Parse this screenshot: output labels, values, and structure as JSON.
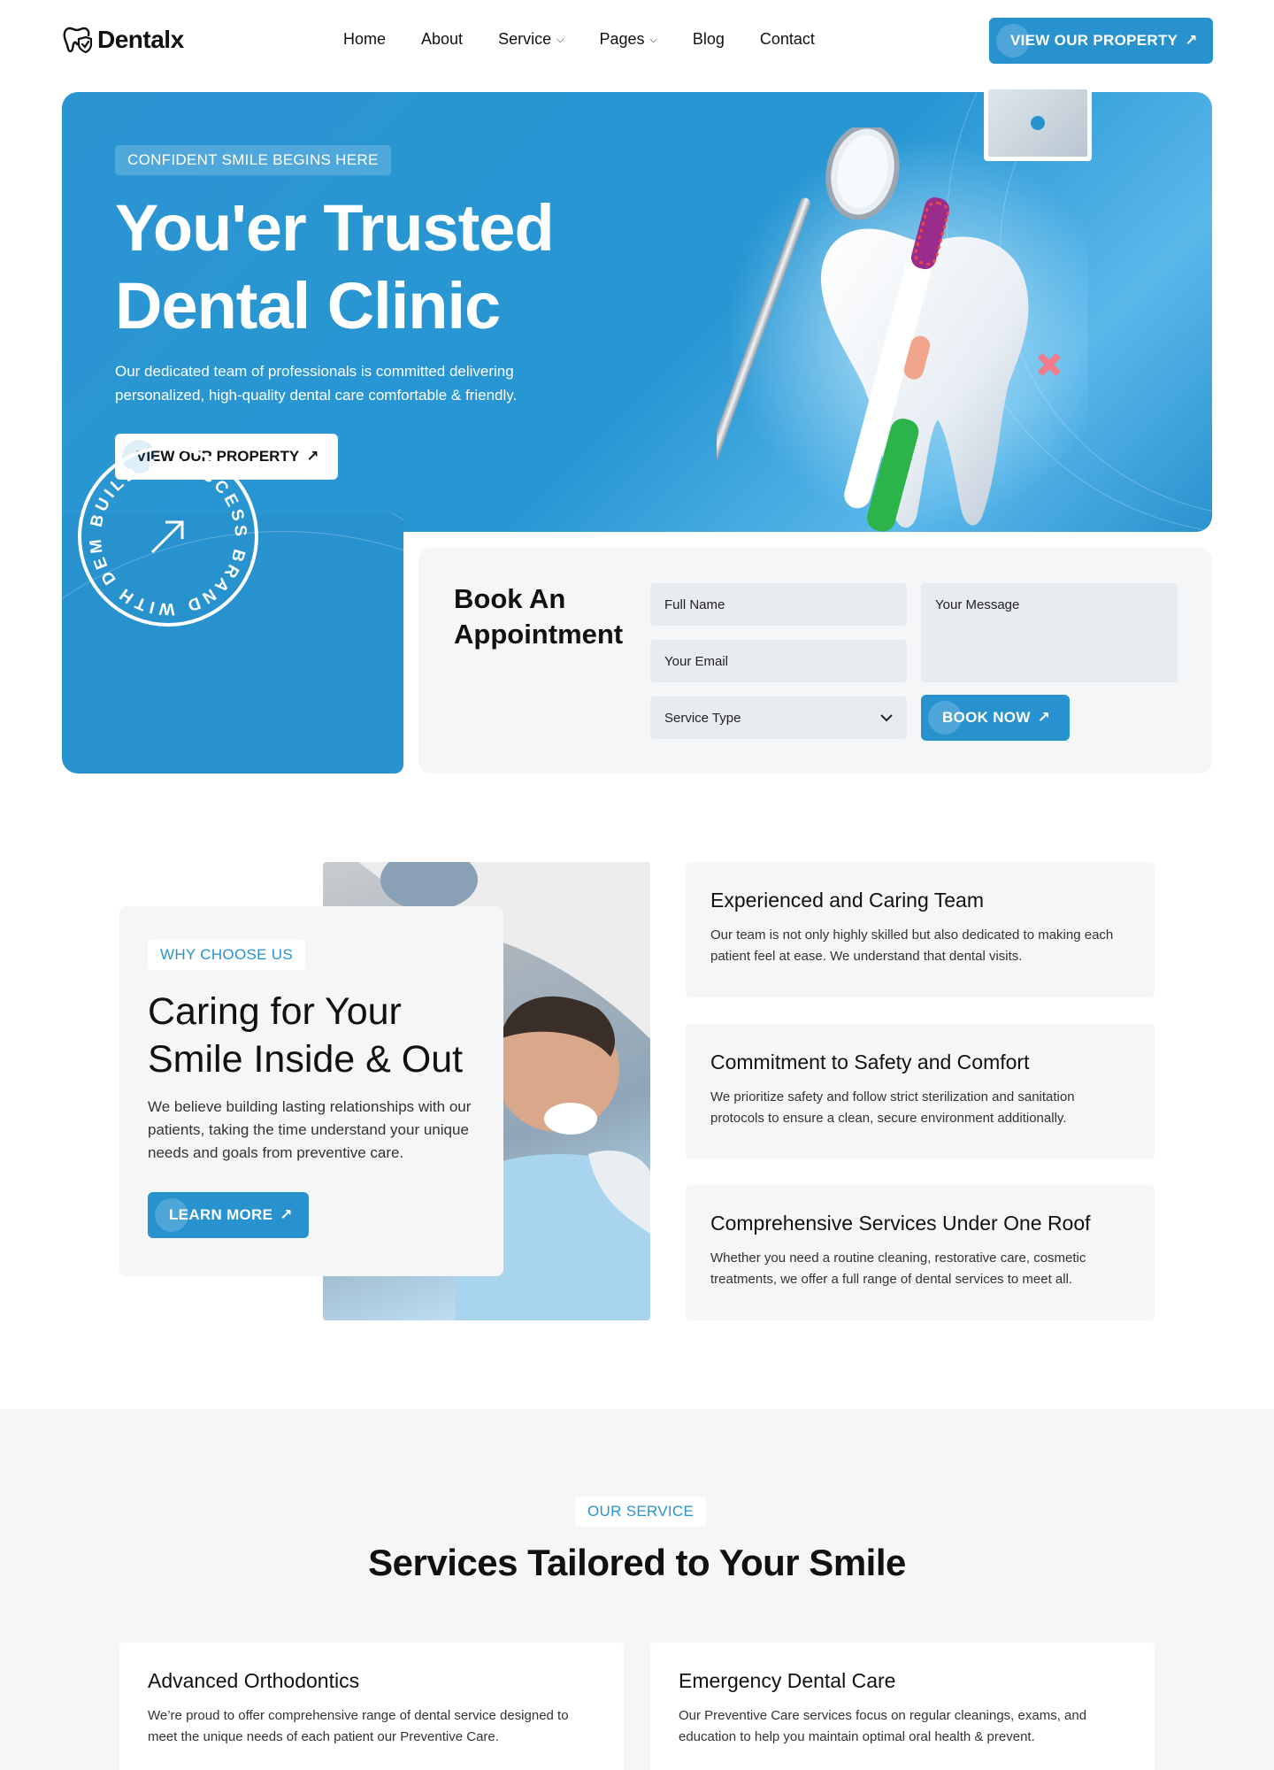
{
  "brand": {
    "name": "Dentalx"
  },
  "nav": {
    "items": [
      {
        "label": "Home",
        "dropdown": false
      },
      {
        "label": "About",
        "dropdown": false
      },
      {
        "label": "Service",
        "dropdown": true
      },
      {
        "label": "Pages",
        "dropdown": true
      },
      {
        "label": "Blog",
        "dropdown": false
      },
      {
        "label": "Contact",
        "dropdown": false
      }
    ],
    "cta_label": "VIEW OUR PROPERTY"
  },
  "hero": {
    "badge": "CONFIDENT SMILE BEGINS HERE",
    "title": "You'er Trusted Dental Clinic",
    "subtitle": "Our dedicated team of professionals is committed delivering personalized, high-quality dental care comfortable & friendly.",
    "button_label": "VIEW OUR PROPERTY",
    "seal_text": "BUILD A SUCCESS BRAND WITH DEMOUI"
  },
  "booking": {
    "title": "Book An Appointment",
    "full_name_placeholder": "Full Name",
    "email_placeholder": "Your Email",
    "service_placeholder": "Service Type",
    "message_placeholder": "Your Message",
    "button_label": "BOOK NOW"
  },
  "why": {
    "badge": "WHY CHOOSE US",
    "title": "Caring for Your Smile Inside & Out",
    "text": "We believe building lasting relationships with our patients, taking the time understand your unique needs and goals from preventive care.",
    "button_label": "LEARN MORE",
    "features": [
      {
        "title": "Experienced and Caring Team",
        "text": "Our team is not only highly skilled but also dedicated to making each patient feel at ease. We understand that dental visits."
      },
      {
        "title": "Commitment to Safety and Comfort",
        "text": "We prioritize safety and follow strict sterilization and sanitation protocols to ensure a clean, secure environment additionally."
      },
      {
        "title": "Comprehensive Services Under One Roof",
        "text": "Whether you need a routine cleaning, restorative care, cosmetic treatments, we offer a full range of dental services to meet all."
      }
    ]
  },
  "services": {
    "badge": "OUR SERVICE",
    "title": "Services Tailored to Your Smile",
    "cards": [
      {
        "title": "Advanced Orthodontics",
        "text": "We’re proud to offer comprehensive range of dental service designed to meet the unique needs of each patient our Preventive Care."
      },
      {
        "title": "Emergency Dental Care",
        "text": "Our Preventive Care services focus on regular cleanings, exams, and education to help you maintain optimal oral health & prevent."
      }
    ]
  },
  "colors": {
    "accent": "#2892cf",
    "light_bg": "#f4f6f8",
    "field_bg": "#e8ebef",
    "sparkle": "#f07b8b"
  }
}
